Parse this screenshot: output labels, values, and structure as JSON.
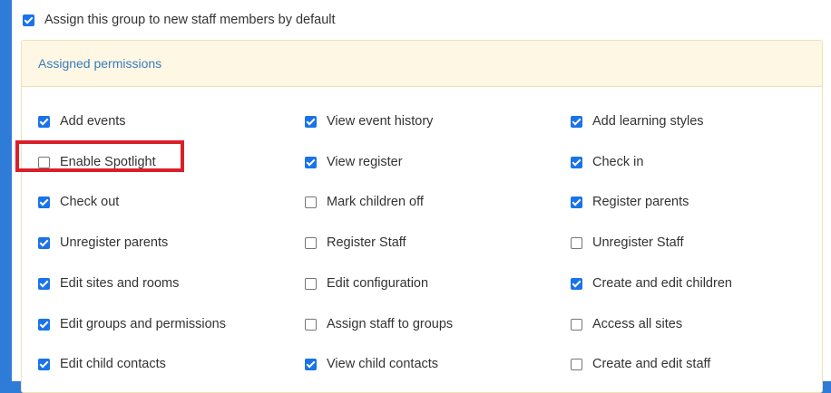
{
  "default_assignment": {
    "label": "Assign this group to new staff members by default",
    "checked": true
  },
  "permissions": {
    "header": "Assigned permissions",
    "columns": [
      [
        {
          "label": "Add events",
          "checked": true
        },
        {
          "label": "Enable Spotlight",
          "checked": false,
          "highlighted": true
        },
        {
          "label": "Check out",
          "checked": true
        },
        {
          "label": "Unregister parents",
          "checked": true
        },
        {
          "label": "Edit sites and rooms",
          "checked": true
        },
        {
          "label": "Edit groups and permissions",
          "checked": true
        },
        {
          "label": "Edit child contacts",
          "checked": true
        }
      ],
      [
        {
          "label": "View event history",
          "checked": true
        },
        {
          "label": "View register",
          "checked": true
        },
        {
          "label": "Mark children off",
          "checked": false
        },
        {
          "label": "Register Staff",
          "checked": false
        },
        {
          "label": "Edit configuration",
          "checked": false
        },
        {
          "label": "Assign staff to groups",
          "checked": false
        },
        {
          "label": "View child contacts",
          "checked": true
        }
      ],
      [
        {
          "label": "Add learning styles",
          "checked": true
        },
        {
          "label": "Check in",
          "checked": true
        },
        {
          "label": "Register parents",
          "checked": true
        },
        {
          "label": "Unregister Staff",
          "checked": false
        },
        {
          "label": "Create and edit children",
          "checked": true
        },
        {
          "label": "Access all sites",
          "checked": false
        },
        {
          "label": "Create and edit staff",
          "checked": false
        }
      ]
    ]
  },
  "colors": {
    "accent": "#1a73e8",
    "background": "#2f7bd8",
    "header_bg": "#fdf7e3",
    "header_text": "#3a7bbf",
    "highlight": "#d9202a"
  }
}
